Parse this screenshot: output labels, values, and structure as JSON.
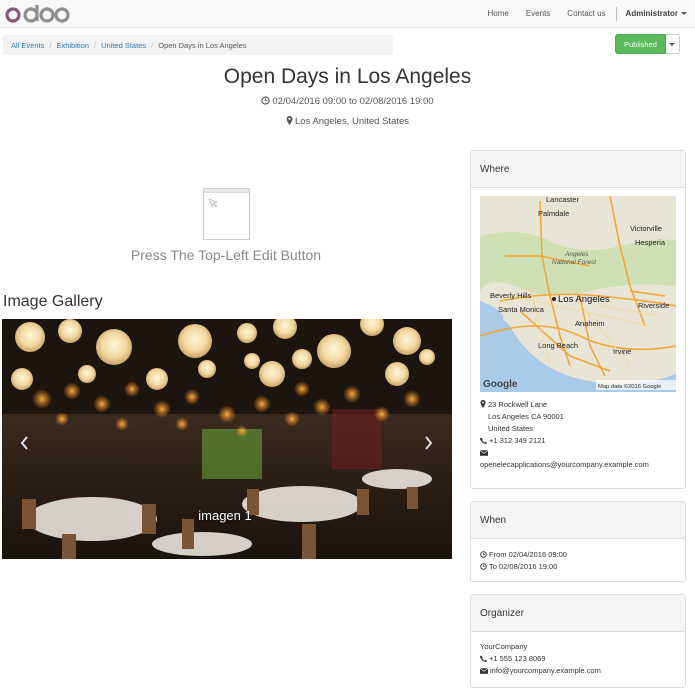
{
  "brand": {
    "name": "odoo",
    "accent": "#875a7b"
  },
  "nav": {
    "items": [
      "Home",
      "Events",
      "Contact us"
    ],
    "user": "Administrator"
  },
  "breadcrumb": {
    "items": [
      "All Events",
      "Exhibition",
      "United States"
    ],
    "current": "Open Days in Los Angeles"
  },
  "publish": {
    "label": "Published",
    "color": "#5cb85c"
  },
  "event": {
    "title": "Open Days in Los Angeles",
    "date_start": "02/04/2016 09:00",
    "date_to": "to",
    "date_end": "02/08/2016 19:00",
    "location": "Los Angeles, United States"
  },
  "placeholder": {
    "text": "Press The Top-Left Edit Button"
  },
  "gallery": {
    "title": "Image Gallery",
    "caption": "imagen 1",
    "prev_icon": "chevron-left-icon",
    "next_icon": "chevron-right-icon"
  },
  "where": {
    "heading": "Where",
    "map_labels": {
      "city_main": "Los Angeles",
      "lancaster": "Lancaster",
      "palmdale": "Palmdale",
      "victorville": "Victorville",
      "hesperia": "Hesperia",
      "forest_line1": "Angeles",
      "forest_line2": "National Forest",
      "beverly": "Beverly Hills",
      "santa_monica": "Santa Monica",
      "anaheim": "Anaheim",
      "riverside": "Riverside",
      "long_beach": "Long Beach",
      "irvine": "Irvine",
      "google": "Google",
      "map_data": "Map data ©2016 Google"
    },
    "address_street": "23 Rockwell Lane",
    "address_city": "Los Angeles CA 90001",
    "address_country": "United States",
    "phone": "+1 312 349 2121",
    "email": "openelecapplications@yourcompany.example.com"
  },
  "when": {
    "heading": "When",
    "from": "From 02/04/2016 09:00",
    "to": "To 02/08/2016 19:00"
  },
  "organizer": {
    "heading": "Organizer",
    "name": "YourCompany",
    "phone": "+1 555 123 8069",
    "email": "info@yourcompany.example.com"
  }
}
